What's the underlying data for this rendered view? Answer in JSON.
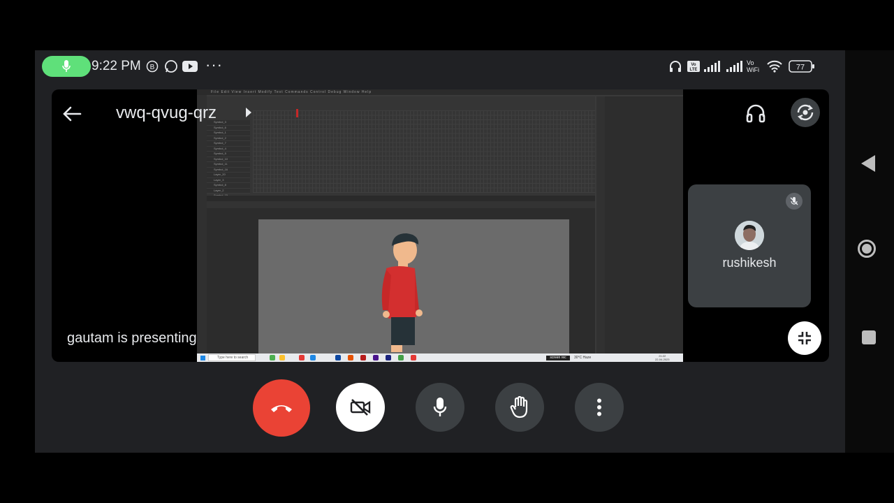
{
  "status_bar": {
    "time": "9:22 PM",
    "more": "···",
    "volte": "Vo LTE",
    "wifi_label": "Vo WiFi",
    "battery": "77"
  },
  "meeting": {
    "code": "vwq-qvug-qrz",
    "presenting_text": "gautam is presenting"
  },
  "participant": {
    "name": "rushikesh"
  },
  "screen_share": {
    "menu": "File  Edit  View  Insert  Modify  Text  Commands  Control  Debug  Window  Help",
    "layers": [
      "Symbol_3",
      "Symbol_6",
      "Symbol_1",
      "Symbol_2",
      "Symbol_7",
      "Symbol_4",
      "Symbol_5",
      "Symbol_10",
      "Symbol_11",
      "Symbol_16",
      "Layer_20",
      "Layer_3",
      "Symbol_8",
      "Layer_2",
      "Symbol_15",
      "Symbol_14"
    ],
    "search_placeholder": "Type here to search",
    "screen_rec": "screen rec",
    "tray": "30°C  Haze",
    "clock_time": "21:22",
    "clock_date": "22-04-2023"
  },
  "colors": {
    "end_call": "#ea4335",
    "mic_pill": "#5fe07a",
    "card_bg": "#000000",
    "control_bg": "#3c4043"
  }
}
